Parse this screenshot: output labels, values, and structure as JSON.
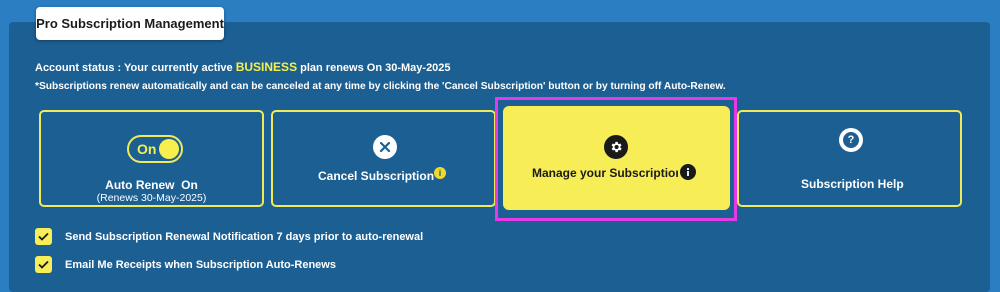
{
  "header": {
    "title": "Pro Subscription Management"
  },
  "status": {
    "prefix": "Account status : Your currently active",
    "plan": "BUSINESS",
    "suffix": "plan renews On 30-May-2025"
  },
  "note": "*Subscriptions renew automatically and can be canceled at any time by clicking the 'Cancel Subscription' button or by turning off Auto-Renew.",
  "cards": {
    "auto_renew": {
      "toggle_label": "On",
      "title": "Auto Renew  On",
      "subtitle": "(Renews 30-May-2025)"
    },
    "cancel": {
      "label": "Cancel Subscription",
      "icon": "close-icon",
      "info_icon": "info-icon"
    },
    "manage": {
      "label": "Manage your Subscription",
      "icon": "gear-icon",
      "info_icon": "info-icon"
    },
    "help": {
      "label": "Subscription Help",
      "icon": "question-icon"
    }
  },
  "options": [
    {
      "label": "Send Subscription Renewal Notification 7 days prior to auto-renewal",
      "checked": true
    },
    {
      "label": "Email Me Receipts when Subscription Auto-Renews",
      "checked": true
    }
  ],
  "colors": {
    "background": "#2a7ec1",
    "panel": "#1c5f93",
    "accent_yellow": "#f6ed57",
    "highlight_magenta": "#e53ae5"
  }
}
